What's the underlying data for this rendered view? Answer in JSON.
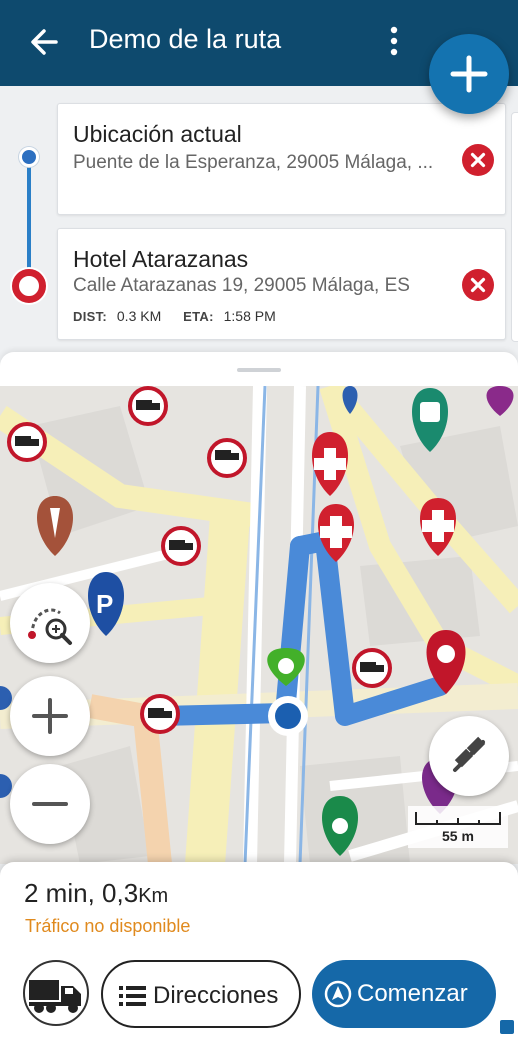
{
  "appbar": {
    "title": "Demo de la ruta",
    "back_icon": "arrow-back-icon",
    "menu_icon": "more-vert-icon",
    "add_icon": "plus-icon",
    "color": "#0e4a6e"
  },
  "route": {
    "origin": {
      "name": "Ubicación actual",
      "address": "Puente de la Esperanza, 29005 Málaga, ..."
    },
    "destination": {
      "name": "Hotel Atarazanas",
      "address": "Calle Atarazanas 19, 29005 Málaga, ES",
      "dist_label": "DIST:",
      "dist_value": "0.3 KM",
      "eta_label": "ETA:",
      "eta_value": "1:58 PM"
    },
    "remove_icon": "close-circle-icon"
  },
  "map": {
    "scale_label": "55 m",
    "route_color": "#4a8ad8"
  },
  "summary": {
    "time": "2 min,",
    "distance_value": "0,3",
    "distance_unit": "Km",
    "traffic": "Tráfico no disponible"
  },
  "actions": {
    "vehicle_icon": "truck-icon",
    "directions_label": "Direcciones",
    "start_label": "Comenzar",
    "accent": "#1568a8"
  }
}
